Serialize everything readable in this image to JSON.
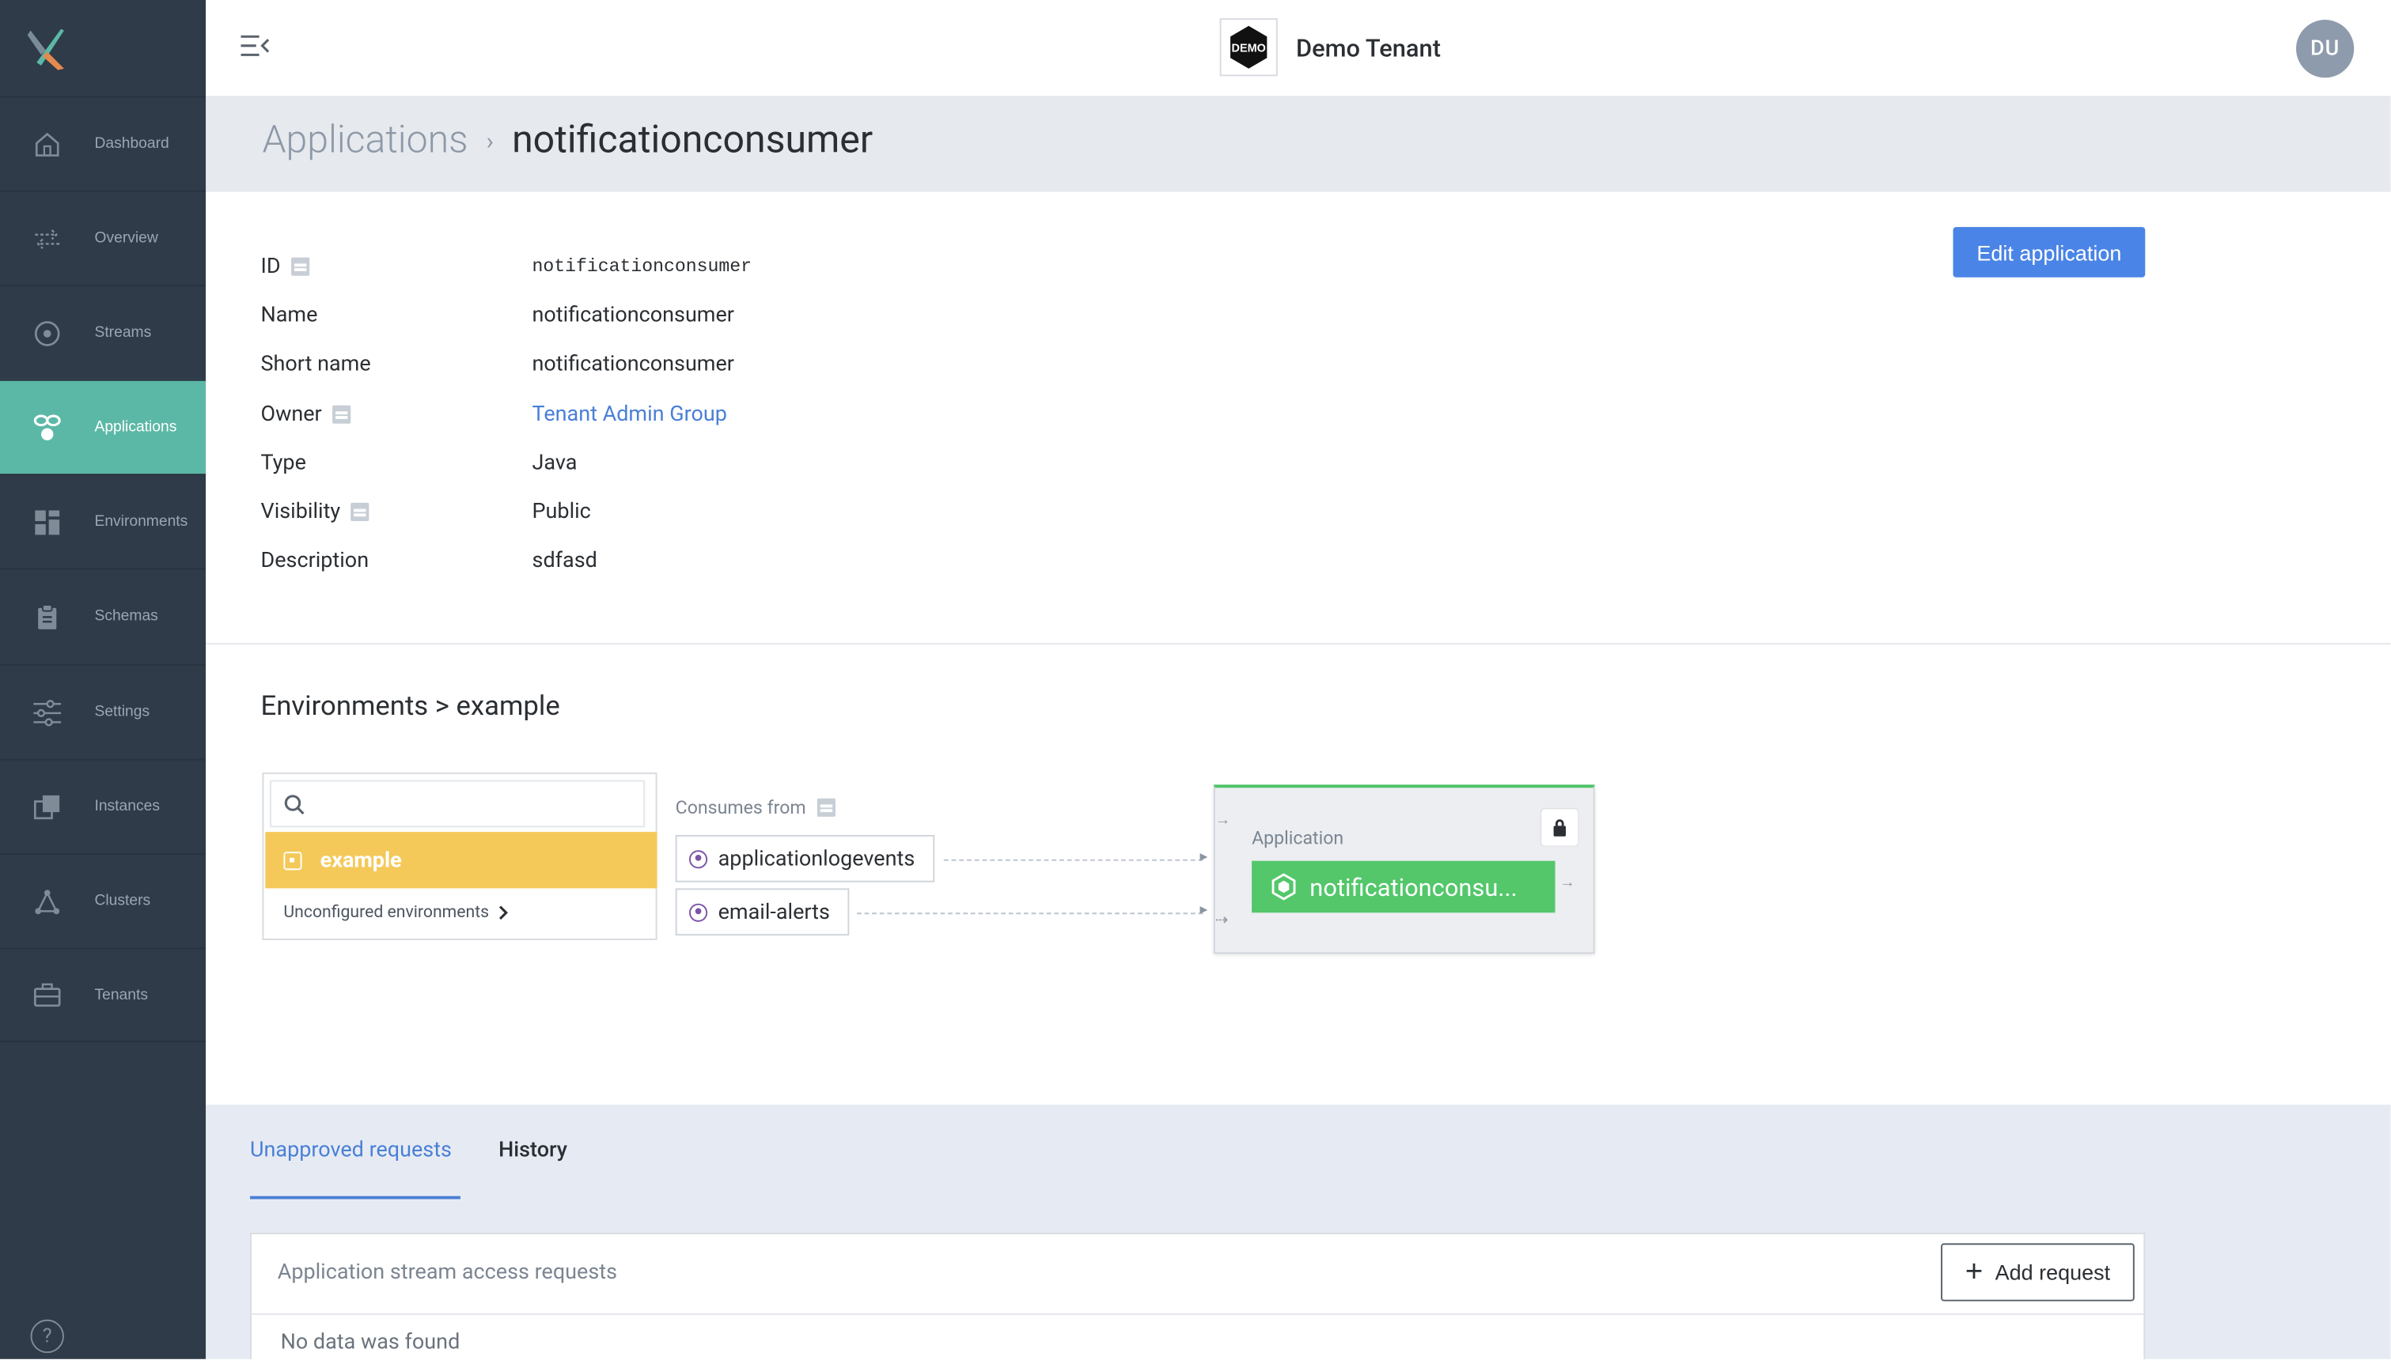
{
  "sidebar": {
    "items": [
      {
        "label": "Dashboard",
        "icon": "home-icon",
        "active": false
      },
      {
        "label": "Overview",
        "icon": "arrows-icon",
        "active": false
      },
      {
        "label": "Streams",
        "icon": "target-icon",
        "active": false
      },
      {
        "label": "Applications",
        "icon": "applications-icon",
        "active": true
      },
      {
        "label": "Environments",
        "icon": "grid-icon",
        "active": false
      },
      {
        "label": "Schemas",
        "icon": "clipboard-icon",
        "active": false
      },
      {
        "label": "Settings",
        "icon": "sliders-icon",
        "active": false
      },
      {
        "label": "Instances",
        "icon": "instances-icon",
        "active": false
      },
      {
        "label": "Clusters",
        "icon": "cluster-icon",
        "active": false
      },
      {
        "label": "Tenants",
        "icon": "briefcase-icon",
        "active": false
      }
    ],
    "help": "?"
  },
  "header": {
    "tenant_logo_text": "DEMO",
    "tenant_name": "Demo Tenant",
    "avatar_initials": "DU"
  },
  "breadcrumb": {
    "parent": "Applications",
    "separator": "›",
    "current": "notificationconsumer"
  },
  "details": {
    "edit_button": "Edit application",
    "fields": [
      {
        "label": "ID",
        "value": "notificationconsumer",
        "info": true
      },
      {
        "label": "Name",
        "value": "notificationconsumer",
        "info": false
      },
      {
        "label": "Short name",
        "value": "notificationconsumer",
        "info": false
      },
      {
        "label": "Owner",
        "value": "Tenant Admin Group",
        "info": true
      },
      {
        "label": "Type",
        "value": "Java",
        "info": false
      },
      {
        "label": "Visibility",
        "value": "Public",
        "info": true
      },
      {
        "label": "Description",
        "value": "sdfasd",
        "info": false
      }
    ]
  },
  "environments": {
    "title": "Environments > example",
    "search_placeholder": "",
    "selected": "example",
    "unconfigured": "Unconfigured environments",
    "consumes_label": "Consumes from",
    "streams": [
      "applicationlogevents",
      "email-alerts"
    ],
    "application_label": "Application",
    "application_name": "notificationconsu..."
  },
  "requests": {
    "tabs": [
      "Unapproved requests",
      "History"
    ],
    "card_title": "Application stream access requests",
    "add_button": "Add request",
    "empty_text": "No data was found"
  },
  "colors": {
    "sidebar_bg": "#2f3b48",
    "active_nav": "#5cb8a6",
    "primary": "#4a84e6",
    "env_selected": "#f4c95a",
    "app_pill": "#53c76a"
  }
}
